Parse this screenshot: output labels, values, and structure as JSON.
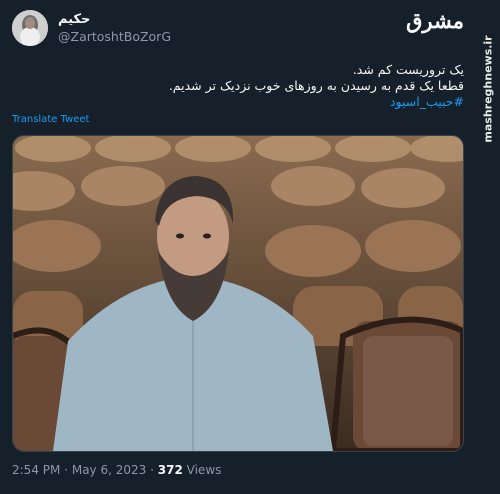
{
  "tweet": {
    "display_name": "حکیم",
    "handle": "@ZartoshtBoZorG",
    "text_line1": "یک تروریست کم شد.",
    "text_line2": "قطعا یک قدم به رسیدن به روزهای خوب نزدیک تر شدیم.",
    "hashtag": "#حبیب_اسیود",
    "translate_label": "Translate Tweet",
    "time": "2:54 PM",
    "date": "May 6, 2023",
    "views_count": "372",
    "views_label": "Views",
    "separator": "·"
  },
  "watermark": {
    "brand": "مشرق",
    "site": "mashreghnews.ir"
  },
  "colors": {
    "background": "#15202b",
    "link": "#1d9bf0",
    "muted": "#8b98a5"
  }
}
